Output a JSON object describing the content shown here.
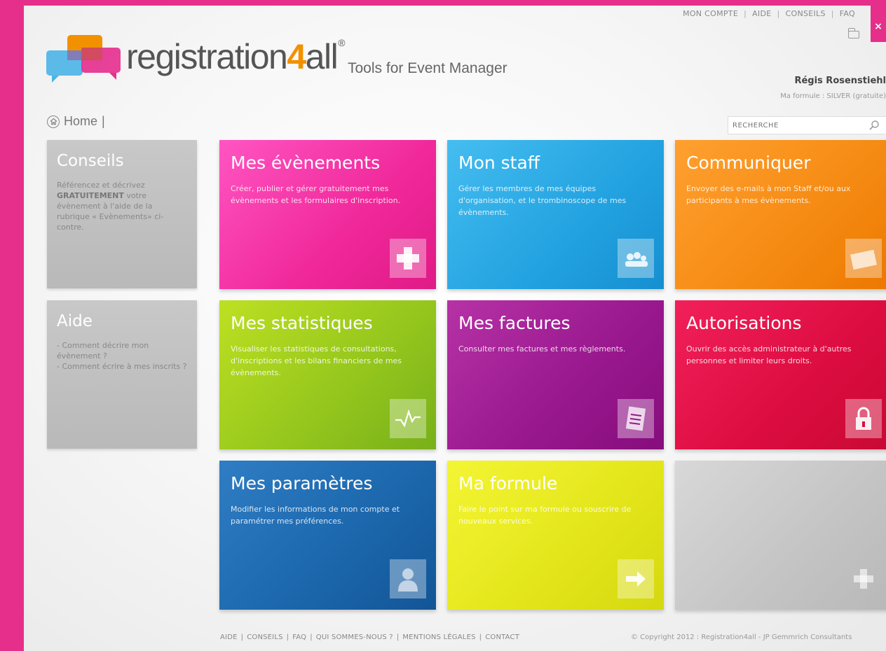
{
  "topnav": {
    "items": [
      "MON COMPTE",
      "AIDE",
      "CONSEILS",
      "FAQ"
    ],
    "close_label": "×"
  },
  "logo": {
    "pre": "registration",
    "four": "4",
    "post": "all",
    "reg": "®",
    "tagline": "Tools for Event Manager"
  },
  "user": {
    "name": "Régis Rosenstiehl",
    "plan": "Ma formule : SILVER (gratuite)"
  },
  "breadcrumb": {
    "home": "Home",
    "sep": "|"
  },
  "search": {
    "placeholder": "RECHERCHE"
  },
  "sidebar": {
    "conseils": {
      "title": "Conseils",
      "text_pre": "Référencez et décrivez ",
      "text_bold": "GRATUITEMENT",
      "text_post": " votre évènement à l'aide de la rubrique « Evènements» ci-contre."
    },
    "aide": {
      "title": "Aide",
      "items": [
        "Comment décrire mon évènement ?",
        "Comment écrire à mes inscrits ?"
      ]
    }
  },
  "tiles": [
    {
      "title": "Mes évènements",
      "desc": "Créer, publier et gérer gratuitement mes évènements et les formulaires d'inscription.",
      "icon": "plus-icon"
    },
    {
      "title": "Mon staff",
      "desc": "Gérer les membres de mes équipes d'organisation, et le trombinoscope de mes évènements.",
      "icon": "group-icon"
    },
    {
      "title": "Communiquer",
      "desc": "Envoyer des e-mails à mon Staff et/ou aux participants à mes évènements.",
      "icon": "envelope-icon"
    },
    {
      "title": "Mes statistiques",
      "desc": "Visualiser les statistiques de consultations, d'inscriptions et les bilans financiers de mes évènements.",
      "icon": "chart-icon"
    },
    {
      "title": "Mes factures",
      "desc": "Consulter mes factures et mes règlements.",
      "icon": "invoice-icon"
    },
    {
      "title": "Autorisations",
      "desc": "Ouvrir des accès administrateur à d'autres personnes et limiter leurs droits.",
      "icon": "lock-icon"
    },
    {
      "title": "Mes paramètres",
      "desc": "Modifier les informations de mon compte et paramétrer mes préférences.",
      "icon": "user-icon"
    },
    {
      "title": "Ma formule",
      "desc": "Faire le point sur ma formule ou souscrire de nouveaux services.",
      "icon": "arrow-icon"
    },
    {
      "title": "",
      "desc": "",
      "icon": "plus-icon"
    }
  ],
  "footer": {
    "links": [
      "AIDE",
      "CONSEILS",
      "FAQ",
      "QUI SOMMES-NOUS ?",
      "MENTIONS LÉGALES",
      "CONTACT"
    ],
    "copyright": "© Copyright 2012 : Registration4all - JP Gemmrich Consultants"
  },
  "colors": {
    "background": "#e52f8a",
    "pink": "#f0289a",
    "blue": "#22a2e0",
    "orange": "#f58a12",
    "green": "#93c51d",
    "purple": "#98178d",
    "red": "#dc0c40",
    "navy": "#1b66ab",
    "yellow": "#e3e51a",
    "grey": "#c4c4c4"
  }
}
